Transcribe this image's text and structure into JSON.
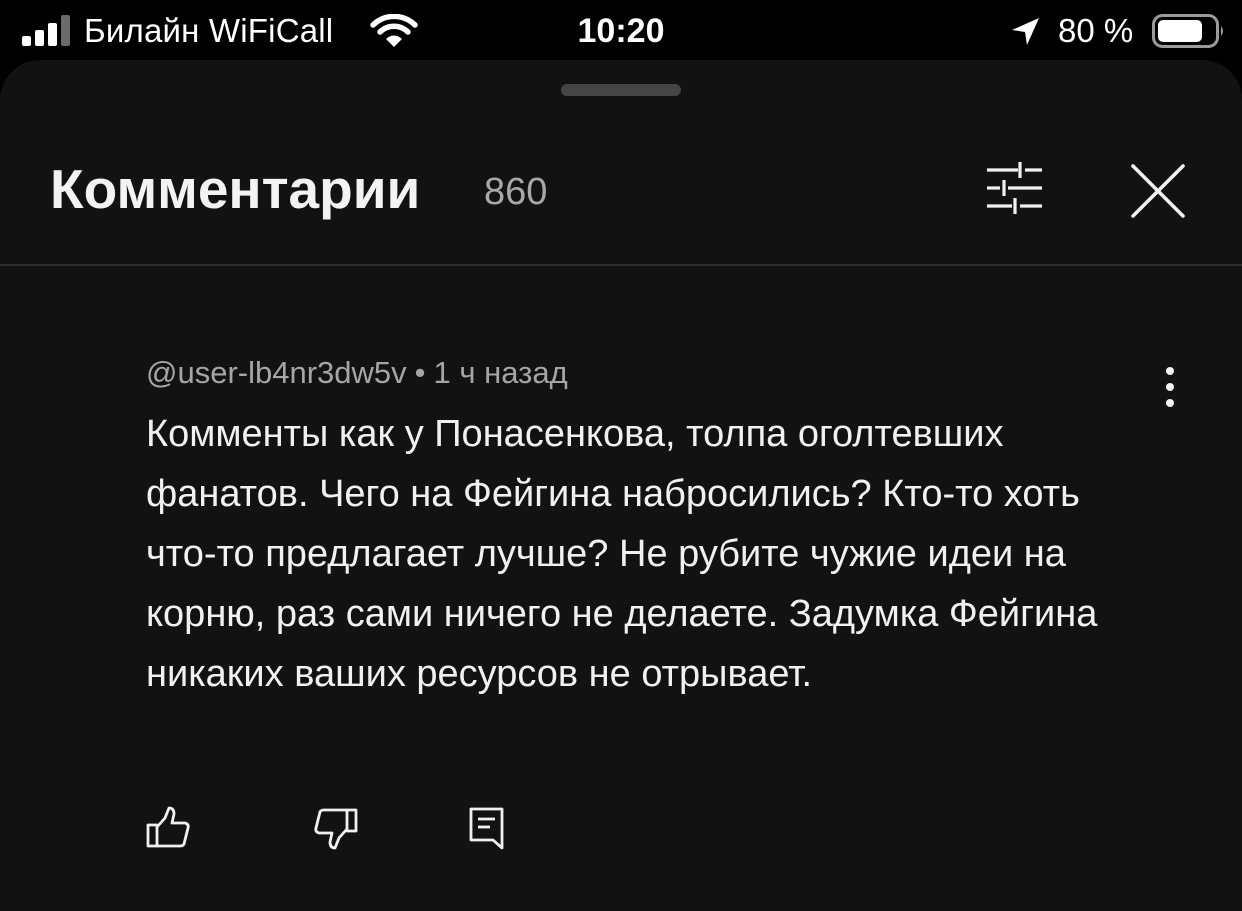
{
  "status_bar": {
    "carrier": "Билайн WiFiCall",
    "time": "10:20",
    "battery_percent_label": "80 %",
    "battery_level": 0.8,
    "icons": [
      "signal-icon",
      "wifi-icon",
      "location-arrow-icon",
      "battery-icon"
    ]
  },
  "comments_sheet": {
    "title": "Комментарии",
    "count": "860",
    "filter_icon": "sliders-icon",
    "close_icon": "close-icon"
  },
  "comment": {
    "author": "@user-lb4nr3dw5v",
    "separator": "•",
    "time_ago": "1 ч назад",
    "text": "Комменты как у Понасенкова, толпа оголтевших фанатов. Чего на Фейгина набросились? Кто-то хоть что-то предлагает лучше? Не рубите чужие идеи на корню, раз сами ничего не делаете. Задумка Фейгина никаких ваших ресурсов не отрывает.",
    "actions": {
      "like_icon": "thumbs-up-icon",
      "dislike_icon": "thumbs-down-icon",
      "reply_icon": "reply-comment-icon",
      "more_icon": "more-vertical-icon"
    }
  },
  "colors": {
    "background": "#000000",
    "sheet": "#121212",
    "primary_text": "#f1f1f1",
    "secondary_text": "#a5a5a5",
    "divider": "#2c2c2c"
  }
}
